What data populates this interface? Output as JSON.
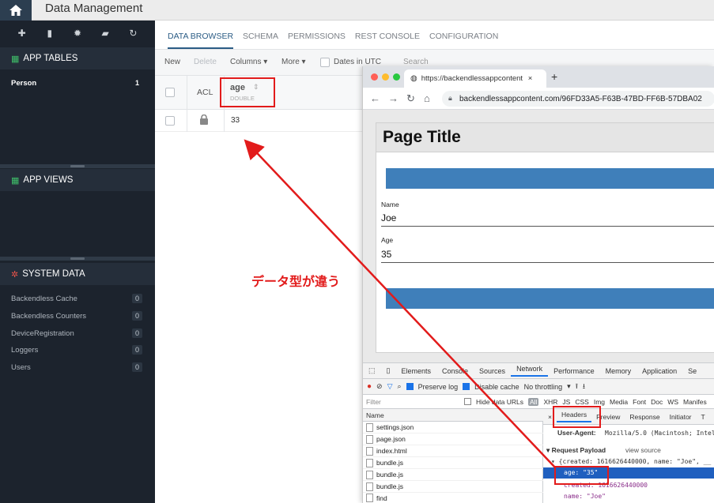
{
  "header": {
    "title": "Data Management"
  },
  "sidebar": {
    "app_tables": {
      "label": "APP TABLES",
      "items": [
        {
          "label": "Person",
          "count": "1"
        }
      ]
    },
    "app_views": {
      "label": "APP VIEWS"
    },
    "system_data": {
      "label": "SYSTEM DATA",
      "items": [
        {
          "label": "Backendless Cache",
          "count": "0"
        },
        {
          "label": "Backendless Counters",
          "count": "0"
        },
        {
          "label": "DeviceRegistration",
          "count": "0"
        },
        {
          "label": "Loggers",
          "count": "0"
        },
        {
          "label": "Users",
          "count": "0"
        }
      ]
    }
  },
  "tabs": [
    "DATA BROWSER",
    "SCHEMA",
    "PERMISSIONS",
    "REST CONSOLE",
    "CONFIGURATION"
  ],
  "toolbar": {
    "new": "New",
    "delete": "Delete",
    "columns": "Columns ▾",
    "more": "More ▾",
    "dates": "Dates in UTC",
    "search": "Search"
  },
  "grid": {
    "acl": "ACL",
    "column": "age",
    "column_type": "DOUBLE",
    "row_value": "33"
  },
  "browser": {
    "tab_title": "https://backendlessappcontent",
    "url": "backendlessappcontent.com/96FD33A5-F63B-47BD-FF6B-57DBA02",
    "page_title": "Page Title",
    "name_label": "Name",
    "name_value": "Joe",
    "age_label": "Age",
    "age_value": "35"
  },
  "devtools": {
    "tabs": [
      "Elements",
      "Console",
      "Sources",
      "Network",
      "Performance",
      "Memory",
      "Application",
      "Se"
    ],
    "preserve_log": "Preserve log",
    "disable_cache": "Disable cache",
    "throttling": "No throttling",
    "filter": "Filter",
    "hide_data_urls": "Hide data URLs",
    "all": "All",
    "filter_types": [
      "XHR",
      "JS",
      "CSS",
      "Img",
      "Media",
      "Font",
      "Doc",
      "WS",
      "Manifes"
    ],
    "name_col": "Name",
    "files": [
      "settings.json",
      "page.json",
      "index.html",
      "bundle.js",
      "bundle.js",
      "bundle.js",
      "find"
    ],
    "detail_tabs": [
      "×",
      "Headers",
      "Preview",
      "Response",
      "Initiator",
      "T"
    ],
    "user_agent_label": "User-Agent:",
    "user_agent_value": "Mozilla/5.0 (Macintosh; Intel M",
    "request_payload": "▾ Request Payload",
    "view_source": "view source",
    "payload_line": "▾ {created: 1616626440000, name: \"Joe\", __",
    "payload_age": "age: \"35\"",
    "payload_created": "created: 1616626440000",
    "payload_name": "name: \"Joe\""
  },
  "annotation": "データ型が違う"
}
